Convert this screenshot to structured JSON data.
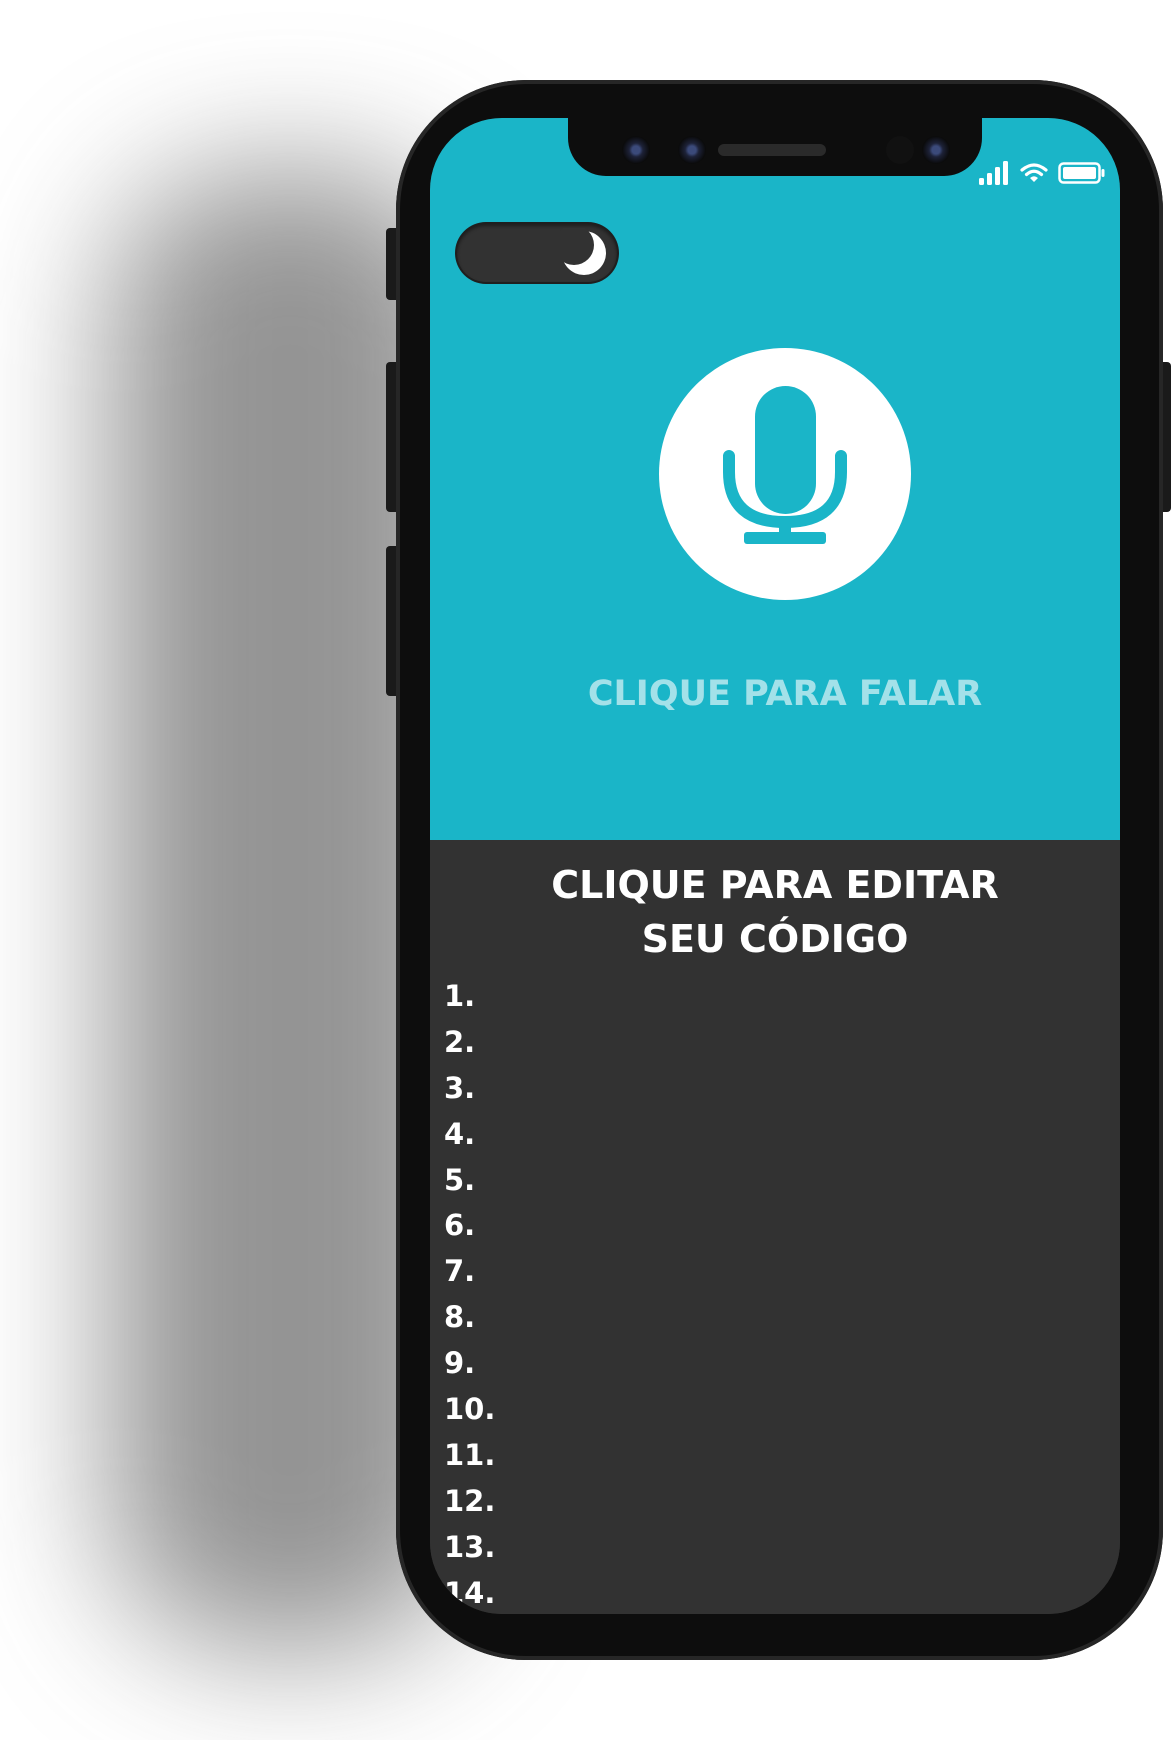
{
  "colors": {
    "accent": "#1ab5c8",
    "speak_label": "#a3e1e9",
    "editor_bg": "#323232",
    "frame": "#0d0d0d",
    "text": "#ffffff"
  },
  "status_bar": {
    "signal_icon": "signal-bars-icon",
    "wifi_icon": "wifi-icon",
    "battery_icon": "battery-icon"
  },
  "theme_toggle": {
    "icon": "moon-icon",
    "state": "dark"
  },
  "voice": {
    "icon": "microphone-icon",
    "label": "CLIQUE PARA FALAR"
  },
  "editor": {
    "title_line1": "CLIQUE PARA EDITAR",
    "title_line2": "SEU CÓDIGO",
    "line_numbers": [
      "1.",
      "2.",
      "3.",
      "4.",
      "5.",
      "6.",
      "7.",
      "8.",
      "9.",
      "10.",
      "11.",
      "12.",
      "13.",
      "14."
    ]
  }
}
